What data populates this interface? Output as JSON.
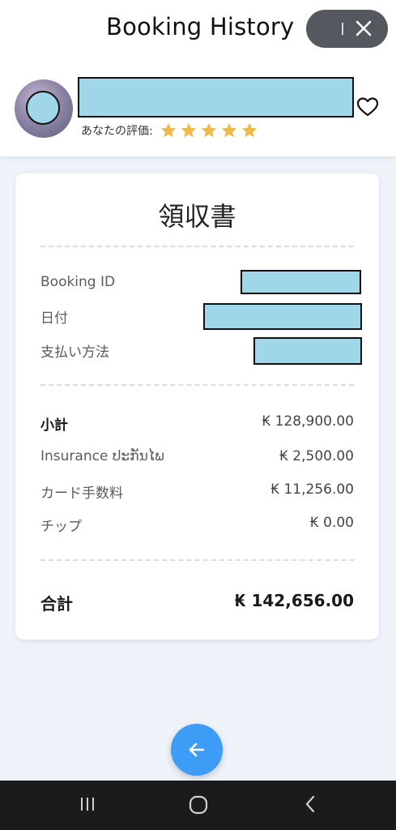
{
  "header": {
    "title": "Booking History",
    "close_icon": "close-icon"
  },
  "driver": {
    "avatar": "avatar",
    "rating_label": "あなたの評価:",
    "rating": 5,
    "rating_max": 5,
    "star_color": "#f0b94a",
    "favorite_icon": "heart-icon"
  },
  "receipt": {
    "title": "領収書",
    "info": [
      {
        "label": "Booking ID"
      },
      {
        "label": "日付"
      },
      {
        "label": "支払い方法"
      }
    ],
    "lines": {
      "subtotal": {
        "label": "小計",
        "value": "₭ 128,900.00"
      },
      "insurance": {
        "label": "Insurance ປະກັນໄພ",
        "value": "₭ 2,500.00"
      },
      "card_fee": {
        "label": "カード手数料",
        "value": "₭ 11,256.00"
      },
      "tip": {
        "label": "チップ",
        "value": "₭ 0.00"
      }
    },
    "total": {
      "label": "合計",
      "value": "₭ 142,656.00"
    }
  },
  "fab": {
    "icon": "arrow-left-icon",
    "color": "#3d9cf5"
  },
  "system_nav": {
    "recents_icon": "recents-icon",
    "home_icon": "home-icon",
    "back_icon": "back-icon"
  }
}
